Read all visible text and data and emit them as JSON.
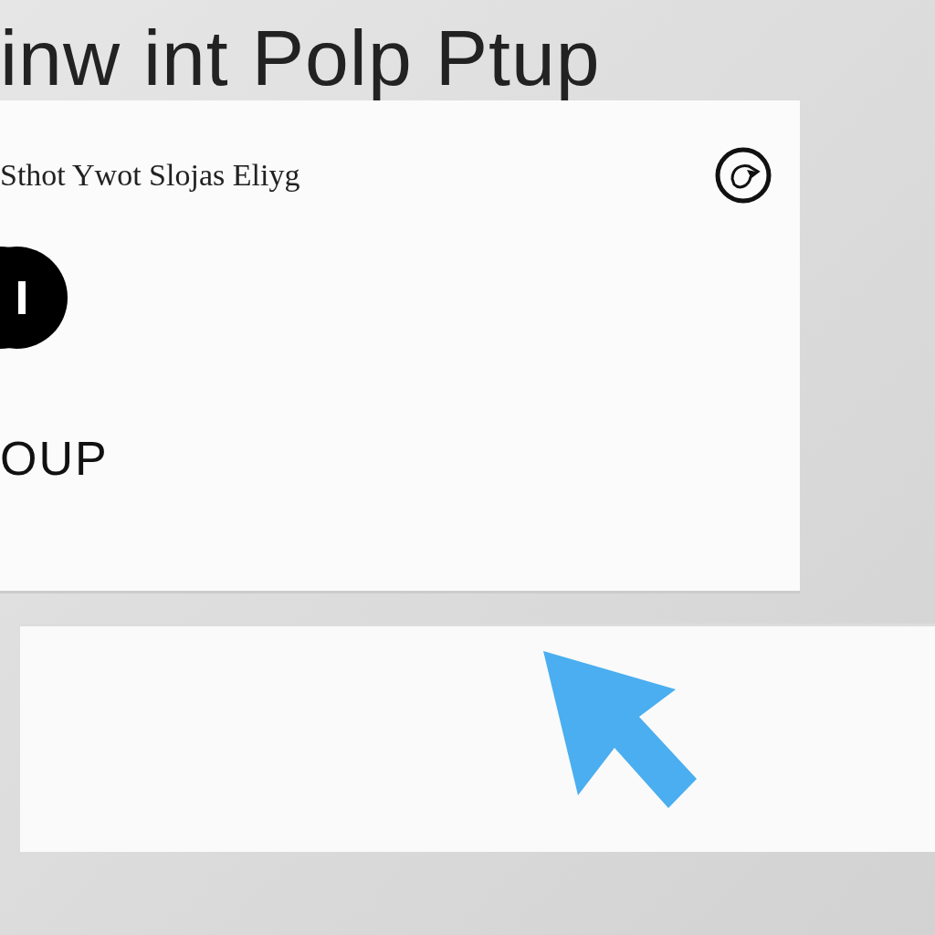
{
  "title": "inw int Polp Ptup",
  "card": {
    "subtitle": "Sthot Ywot Slojas Eliyg",
    "label": "OUP"
  }
}
